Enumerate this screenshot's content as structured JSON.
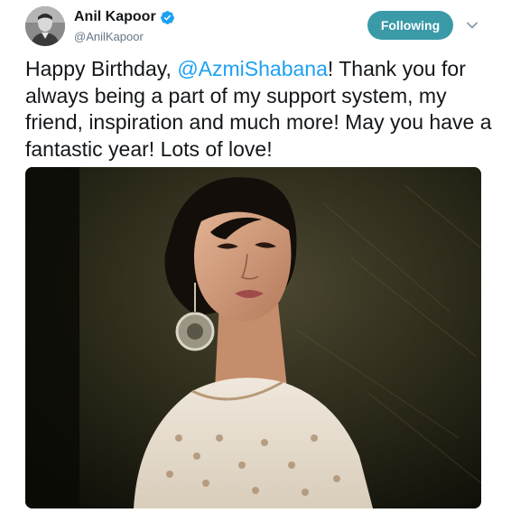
{
  "tweet": {
    "author": {
      "display_name": "Anil Kapoor",
      "handle": "@AnilKapoor",
      "verified": true,
      "avatar_icon": "profile-photo"
    },
    "follow_button": {
      "label": "Following",
      "color": "#3a9aa8"
    },
    "menu_icon": "chevron-down-icon",
    "text": {
      "before_mention": "Happy Birthday, ",
      "mention": "@AzmiShabana",
      "after_mention": "! Thank you for always being a part of my support system, my friend, inspiration and much more! May you have a fantastic year! Lots of love!"
    },
    "colors": {
      "link": "#1da1f2",
      "text": "#14171a",
      "secondary": "#657786",
      "verified": "#1da1f2"
    },
    "media": {
      "kind": "photo"
    }
  }
}
